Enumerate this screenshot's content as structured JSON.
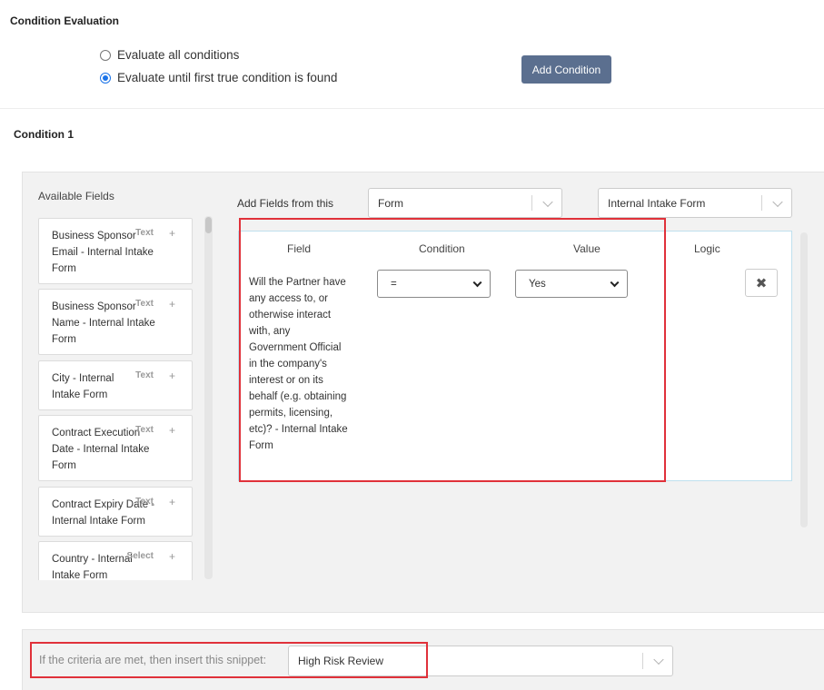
{
  "evaluation": {
    "title": "Condition Evaluation",
    "options": [
      {
        "label": "Evaluate all conditions",
        "checked": false
      },
      {
        "label": "Evaluate until first true condition is found",
        "checked": true
      }
    ],
    "add_condition_label": "Add Condition"
  },
  "condition": {
    "title": "Condition 1",
    "available_fields": {
      "title": "Available Fields",
      "items": [
        {
          "name": "Business Sponsor Email - Internal Intake Form",
          "type": "Text"
        },
        {
          "name": "Business Sponsor Name - Internal Intake Form",
          "type": "Text"
        },
        {
          "name": "City - Internal Intake Form",
          "type": "Text"
        },
        {
          "name": "Contract Execution Date - Internal Intake Form",
          "type": "Text"
        },
        {
          "name": "Contract Expiry Date - Internal Intake Form",
          "type": "Text"
        },
        {
          "name": "Country - Internal Intake Form",
          "type": "Select"
        }
      ],
      "add_symbol": "+"
    },
    "add_fields_label": "Add Fields from this",
    "source_type": "Form",
    "source_form": "Internal Intake Form",
    "table": {
      "headers": {
        "field": "Field",
        "condition": "Condition",
        "value": "Value",
        "logic": "Logic"
      },
      "row": {
        "field": "Will the Partner have any access to, or otherwise interact with, any Government Official in the company's interest or on its behalf (e.g. obtaining permits, licensing, etc)? - Internal Intake Form",
        "condition": "=",
        "value": "Yes",
        "remove_symbol": "✖"
      }
    }
  },
  "snippet": {
    "label": "If the criteria are met, then insert this snippet:",
    "value": "High Risk Review"
  },
  "colors": {
    "primary_button": "#5b6f8f",
    "highlight_border": "#e0313a",
    "radio_checked": "#1a73e8"
  }
}
